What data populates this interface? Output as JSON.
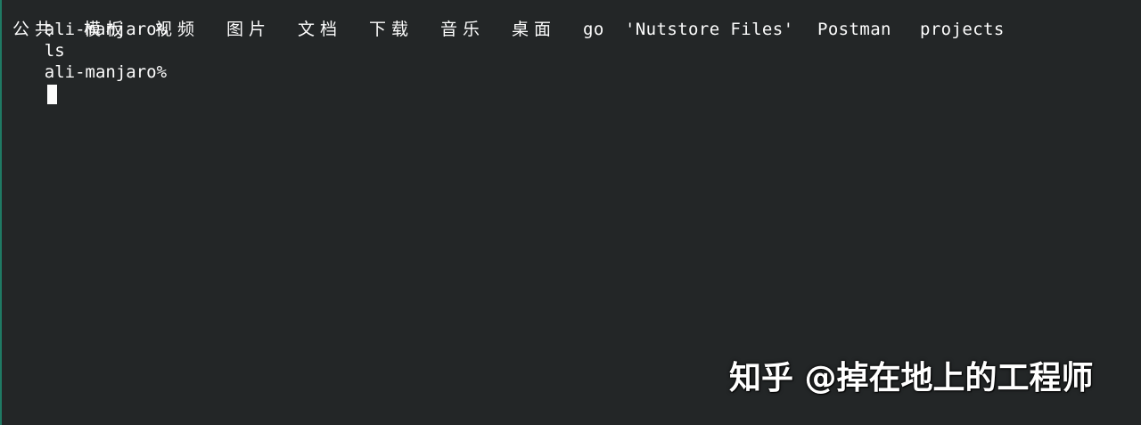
{
  "terminal": {
    "prompt": "ali-manjaro%",
    "command": "ls",
    "ls_output": [
      "公共",
      "模板",
      "视频",
      "图片",
      "文档",
      "下载",
      "音乐",
      "桌面",
      "go",
      "'Nutstore Files'",
      "Postman",
      "projects"
    ],
    "prompt_2": "ali-manjaro%"
  },
  "watermark": {
    "text": "知乎 @掉在地上的工程师"
  },
  "colors": {
    "background": "#232627",
    "foreground": "#fcfcfc",
    "left_edge": "#1f8a70"
  },
  "icons": {
    "cursor": "block-cursor"
  }
}
